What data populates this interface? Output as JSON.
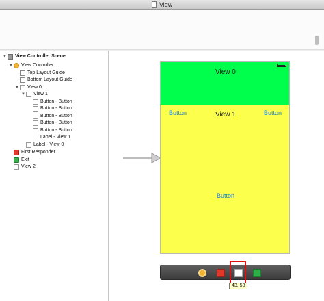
{
  "window": {
    "title": "View"
  },
  "outline": {
    "scene": "View Controller Scene",
    "view_controller": "View Controller",
    "top_guide": "Top Layout Guide",
    "bottom_guide": "Bottom Layout Guide",
    "view0": "View 0",
    "view1": "View 1",
    "buttons": [
      "Button - Button",
      "Button - Button",
      "Button - Button",
      "Button - Button",
      "Button - Button"
    ],
    "label_view1": "Label - View 1",
    "label_view0": "Label - View 0",
    "first_responder": "First Responder",
    "exit": "Exit",
    "view2": "View 2"
  },
  "canvas": {
    "view0_label": "View 0",
    "view1_label": "View 1",
    "button_left": "Button",
    "button_right": "Button",
    "button_center": "Button",
    "colors": {
      "view0": "#00ff4c",
      "view1": "#fdff4d",
      "button_text": "#1a7fd6"
    }
  },
  "dock": {
    "tooltip": "43, 58"
  }
}
